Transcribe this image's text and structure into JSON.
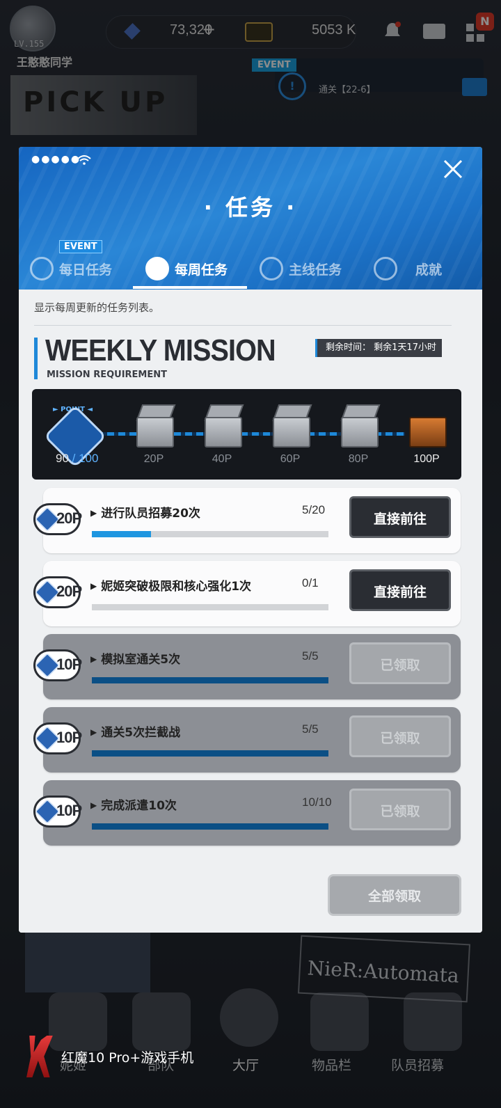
{
  "hud": {
    "level": "LV.155",
    "player_name": "王憨憨同学",
    "currency1": "73,320",
    "currency1_plus": "+",
    "currency2": "5053 K",
    "notif_badge": "N",
    "event_tag": "EVENT",
    "event_text": "通关【22-6】",
    "pickup_text": "PICK UP"
  },
  "background": {
    "automata": "NieR:Automata",
    "nav": [
      "妮姬",
      "部队",
      "大厅",
      "物品栏",
      "队员招募"
    ]
  },
  "brand": "红魔10 Pro+游戏手机",
  "modal": {
    "status_dots": "●●●●●",
    "title": "· 任务 ·",
    "event_tag": "EVENT",
    "tabs": [
      {
        "label": "每日任务",
        "icon": "daily-icon"
      },
      {
        "label": "每周任务",
        "icon": "weekly-moon-icon",
        "active": true
      },
      {
        "label": "主线任务",
        "icon": "globe-icon"
      },
      {
        "label": "成就",
        "icon": "star-icon"
      }
    ],
    "description": "显示每周更新的任务列表。",
    "section_title": "WEEKLY MISSION",
    "section_subtitle": "MISSION REQUIREMENT",
    "remaining_label": "剩余时间：",
    "remaining_value": "剩余1天17小时",
    "point_label": "► POINT ◄",
    "point_current": "90",
    "point_sep": " / ",
    "point_max": "100",
    "milestones": [
      "20P",
      "40P",
      "60P",
      "80P",
      "100P"
    ],
    "missions": [
      {
        "points": "20P",
        "name": "进行队员招募20次",
        "progress": "5/20",
        "fraction": 0.25,
        "button": "直接前往",
        "done": false
      },
      {
        "points": "20P",
        "name": "妮姬突破极限和核心强化1次",
        "progress": "0/1",
        "fraction": 0,
        "button": "直接前往",
        "done": false
      },
      {
        "points": "10P",
        "name": "模拟室通关5次",
        "progress": "5/5",
        "fraction": 1,
        "button": "已领取",
        "done": true
      },
      {
        "points": "10P",
        "name": "通关5次拦截战",
        "progress": "5/5",
        "fraction": 1,
        "button": "已领取",
        "done": true
      },
      {
        "points": "10P",
        "name": "完成派遣10次",
        "progress": "10/10",
        "fraction": 1,
        "button": "已领取",
        "done": true
      }
    ],
    "claim_all": "全部领取"
  }
}
